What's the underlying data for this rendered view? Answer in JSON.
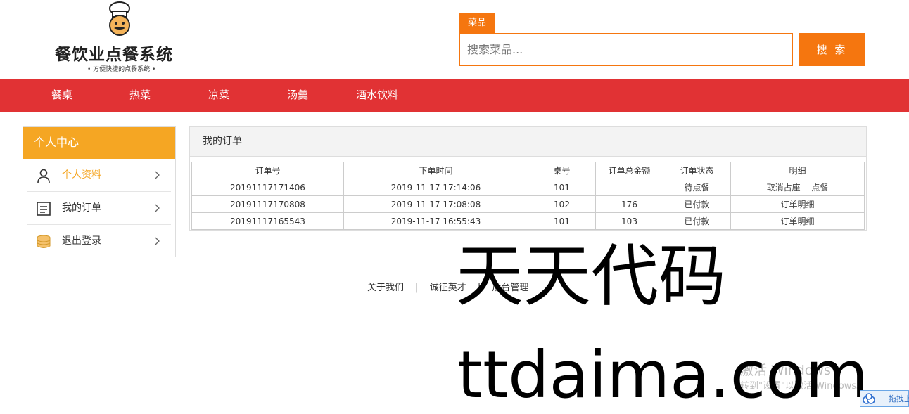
{
  "header": {
    "logo_title": "餐饮业点餐系统",
    "logo_subtitle": "• 方便快捷的点餐系统 •",
    "search_tab": "菜品",
    "search_placeholder": "搜索菜品...",
    "search_button": "搜 索"
  },
  "nav": {
    "items": [
      {
        "label": "餐桌"
      },
      {
        "label": "热菜"
      },
      {
        "label": "凉菜"
      },
      {
        "label": "汤羹"
      },
      {
        "label": "酒水饮料"
      }
    ]
  },
  "sidebar": {
    "title": "个人中心",
    "items": [
      {
        "label": "个人资料",
        "icon": "user-icon"
      },
      {
        "label": "我的订单",
        "icon": "order-list-icon"
      },
      {
        "label": "退出登录",
        "icon": "coins-icon"
      }
    ]
  },
  "orders": {
    "title": "我的订单",
    "columns": [
      "订单号",
      "下单时间",
      "桌号",
      "订单总金额",
      "订单状态",
      "明细"
    ],
    "rows": [
      {
        "id": "20191117171406",
        "time": "2019-11-17 17:14:06",
        "table": "101",
        "total": "",
        "status": "待点餐",
        "actions": [
          "取消占座",
          "点餐"
        ]
      },
      {
        "id": "20191117170808",
        "time": "2019-11-17 17:08:08",
        "table": "102",
        "total": "176",
        "status": "已付款",
        "actions": [
          "订单明细"
        ]
      },
      {
        "id": "20191117165543",
        "time": "2019-11-17 16:55:43",
        "table": "101",
        "total": "103",
        "status": "已付款",
        "actions": [
          "订单明细"
        ]
      }
    ]
  },
  "footer": {
    "links": [
      "关于我们",
      "诚征英才",
      "后台管理"
    ],
    "separator": "|"
  },
  "watermark": {
    "line1": "天天代码",
    "line2": "ttdaima.com"
  },
  "windows_activation": {
    "line1": "激活 Windows",
    "line2": "转到\"设置\"以激活 Windows。"
  },
  "float_widget": {
    "label": "拖拽上"
  },
  "colors": {
    "accent_orange": "#f5760f",
    "nav_red": "#e13234",
    "sidebar_orange": "#f5a623"
  }
}
